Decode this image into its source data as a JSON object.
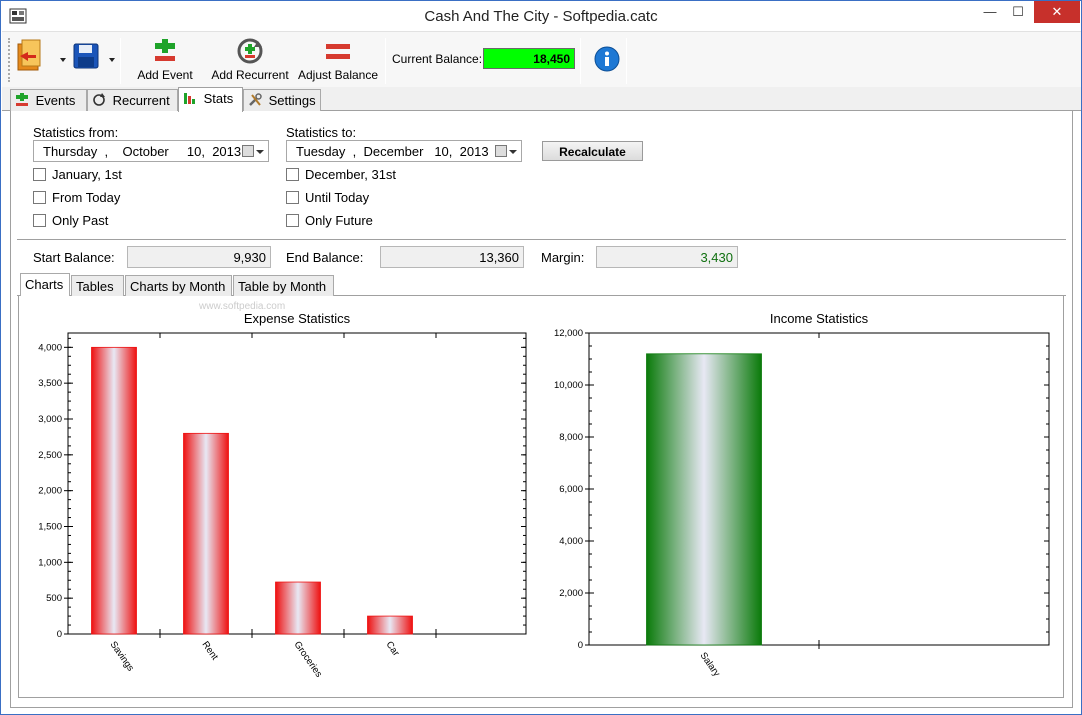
{
  "window": {
    "title": "Cash And The City - Softpedia.catc",
    "minimize": "—",
    "maximize": "☐",
    "close": "✕"
  },
  "toolbar": {
    "add_event": "Add Event",
    "add_recurrent": "Add Recurrent",
    "adjust_balance": "Adjust Balance",
    "current_balance_label": "Current Balance:",
    "current_balance_value": "18,450",
    "balance_color": "#00ff00"
  },
  "tabs": [
    {
      "label": "Events",
      "icon": "plus-minus-icon"
    },
    {
      "label": "Recurrent",
      "icon": "refresh-icon"
    },
    {
      "label": "Stats",
      "icon": "bar-chart-icon",
      "active": true
    },
    {
      "label": "Settings",
      "icon": "tools-icon"
    }
  ],
  "stats": {
    "from_label": "Statistics from:",
    "from_date": {
      "weekday": "Thursday",
      "month": "October",
      "day": "10",
      "year": "2013"
    },
    "to_label": "Statistics to:",
    "to_date": {
      "weekday": "Tuesday",
      "month": "December",
      "day": "10",
      "year": "2013"
    },
    "from_options": [
      "January, 1st",
      "From Today",
      "Only Past"
    ],
    "to_options": [
      "December, 31st",
      "Until Today",
      "Only Future"
    ],
    "recalculate": "Recalculate",
    "start_balance_label": "Start Balance:",
    "start_balance": "9,930",
    "end_balance_label": "End Balance:",
    "end_balance": "13,360",
    "margin_label": "Margin:",
    "margin": "3,430",
    "margin_color": "#107010"
  },
  "subtabs": [
    {
      "label": "Charts",
      "active": true
    },
    {
      "label": "Tables"
    },
    {
      "label": "Charts by Month"
    },
    {
      "label": "Table by Month"
    }
  ],
  "watermark": "www.softpedia.com",
  "chart_data": [
    {
      "type": "bar",
      "title": "Expense Statistics",
      "categories": [
        "Savings",
        "Rent",
        "Groceries",
        "Car"
      ],
      "values": [
        4000,
        2800,
        725,
        250
      ],
      "ylim": [
        0,
        4200
      ],
      "yticks": [
        0,
        500,
        1000,
        1500,
        2000,
        2500,
        3000,
        3500,
        4000
      ],
      "ytick_labels": [
        "0",
        "500",
        "1,000",
        "1,500",
        "2,000",
        "2,500",
        "3,000",
        "3,500",
        "4,000"
      ],
      "color": "#ee1111",
      "xlabel": "",
      "ylabel": ""
    },
    {
      "type": "bar",
      "title": "Income Statistics",
      "categories": [
        "Salary"
      ],
      "values": [
        11200
      ],
      "ylim": [
        0,
        12000
      ],
      "yticks": [
        0,
        2000,
        4000,
        6000,
        8000,
        10000,
        12000
      ],
      "ytick_labels": [
        "0",
        "2,000",
        "4,000",
        "6,000",
        "8,000",
        "10,000",
        "12,000"
      ],
      "color": "#0a7a0a",
      "xlabel": "",
      "ylabel": ""
    }
  ]
}
